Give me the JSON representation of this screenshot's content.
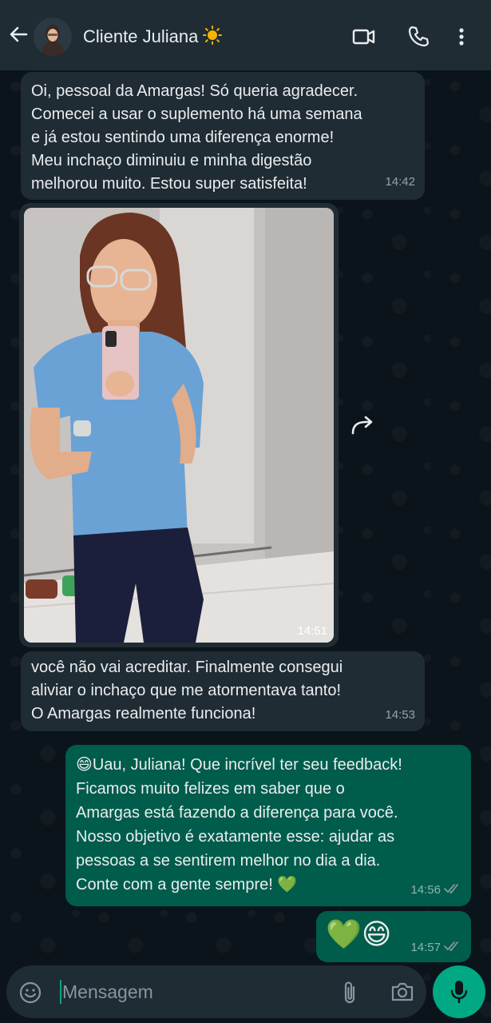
{
  "header": {
    "back_icon": "arrow-left-icon",
    "contact_name": "Cliente Juliana",
    "contact_emoji": "sun-emoji",
    "video_icon": "video-call-icon",
    "call_icon": "phone-icon",
    "menu_icon": "more-vertical-icon"
  },
  "messages": [
    {
      "direction": "in",
      "text": "Oi, pessoal da Amargas! Só queria agradecer.\nComecei a usar o suplemento há uma semana\ne já estou sentindo uma diferença enorme!\nMeu inchaço diminuiu e minha digestão\nmelhorou muito. Estou super satisfeita!",
      "time": "14:42"
    },
    {
      "direction": "in",
      "type": "image",
      "time": "14:51"
    },
    {
      "direction": "in",
      "text": "você não vai acreditar. Finalmente consegui\naliviar o inchaço que me atormentava tanto!\nO Amargas realmente funciona!",
      "time": "14:53"
    },
    {
      "direction": "out",
      "text": "😄Uau, Juliana! Que incrível ter seu feedback!\nFicamos muito felizes em saber que o\nAmargas está fazendo a diferença para você.\nNosso objetivo é exatamente esse: ajudar as\npessoas a se sentirem melhor no dia a dia.\nConte com a gente sempre! 💚",
      "time": "14:56",
      "status": "read"
    },
    {
      "direction": "out",
      "text": "💚😄",
      "time": "14:57",
      "status": "read"
    }
  ],
  "input": {
    "placeholder": "Mensagem",
    "emoji_icon": "emoji-icon",
    "attach_icon": "paperclip-icon",
    "camera_icon": "camera-icon",
    "mic_icon": "microphone-icon"
  },
  "colors": {
    "header_bg": "#1f2c34",
    "incoming_bubble": "#202c33",
    "outgoing_bubble": "#005c4b",
    "accent": "#00a884",
    "background": "#0b141a"
  }
}
